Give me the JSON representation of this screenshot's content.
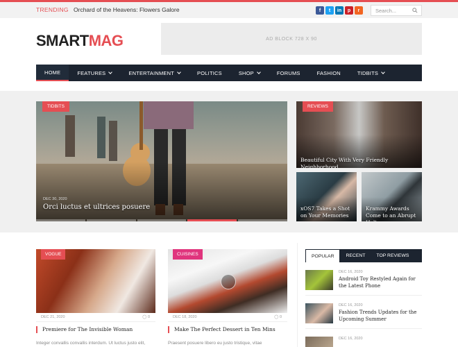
{
  "topbar": {
    "trending_label": "TRENDING",
    "trending_text": "Orchard of the Heavens: Flowers Galore",
    "socials": [
      {
        "name": "facebook-icon",
        "glyph": "f",
        "color": "#3b5998"
      },
      {
        "name": "twitter-icon",
        "glyph": "t",
        "color": "#1da1f2"
      },
      {
        "name": "linkedin-icon",
        "glyph": "in",
        "color": "#0077b5"
      },
      {
        "name": "pinterest-icon",
        "glyph": "p",
        "color": "#cb2027"
      },
      {
        "name": "rss-icon",
        "glyph": "r",
        "color": "#f26522"
      }
    ],
    "search_placeholder": "Search..."
  },
  "header": {
    "logo_a": "SMART",
    "logo_b": "MAG",
    "ad_text": "AD BLOCK  728 X 90"
  },
  "nav": {
    "items": [
      {
        "label": "HOME",
        "active": true,
        "caret": false
      },
      {
        "label": "FEATURES",
        "active": false,
        "caret": true
      },
      {
        "label": "ENTERTAINMENT",
        "active": false,
        "caret": true
      },
      {
        "label": "POLITICS",
        "active": false,
        "caret": false
      },
      {
        "label": "SHOP",
        "active": false,
        "caret": true
      },
      {
        "label": "FORUMS",
        "active": false,
        "caret": false
      },
      {
        "label": "FASHION",
        "active": false,
        "caret": false
      },
      {
        "label": "TIDBITS",
        "active": false,
        "caret": true
      }
    ]
  },
  "featured": {
    "main": {
      "category": "TIDBITS",
      "date": "DEC 30, 2020",
      "title": "Orci luctus et ultrices posuere"
    },
    "side1": {
      "category": "REVIEWS",
      "title": "Beautiful City With Very Friendly Neighborhood"
    },
    "side2": {
      "title": "xOS7 Takes a Shot on Your Memories"
    },
    "side3": {
      "title": "Krammy Awards Come to an Abrupt Halt"
    }
  },
  "articles": [
    {
      "category": "VOGUE",
      "cat_color": "#e54e53",
      "date": "DEC 21, 2020",
      "comments": "0",
      "title": "Premiere for The Invisible Woman",
      "excerpt": "Integer convallis convallis interdum. Ut luctus justo elit,"
    },
    {
      "category": "CUISINES",
      "cat_color": "#e0347d",
      "date": "DEC 18, 2020",
      "comments": "0",
      "title": "Make The Perfect Dessert in Ten Mins",
      "excerpt": "Praesent posuere libero eu justo tristique, vitae"
    }
  ],
  "sidebar": {
    "tabs": [
      "POPULAR",
      "RECENT",
      "TOP REVIEWS"
    ],
    "items": [
      {
        "date": "DEC 16, 2020",
        "title": "Android Toy Restyled Again for the Latest Phone"
      },
      {
        "date": "DEC 16, 2020",
        "title": "Fashion Trends Updates for the Upcoming Summer"
      },
      {
        "date": "DEC 16, 2020",
        "title": ""
      }
    ]
  }
}
